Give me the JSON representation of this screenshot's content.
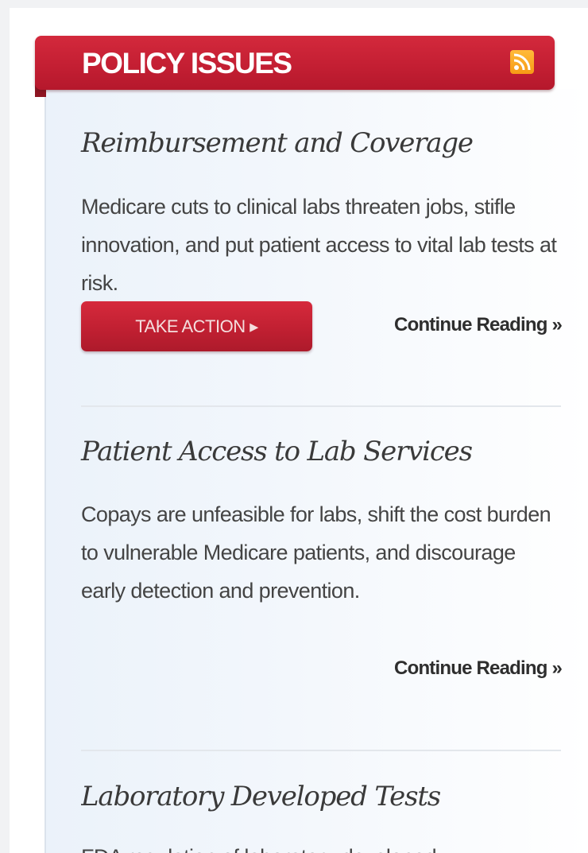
{
  "header": {
    "title": "POLICY ISSUES",
    "icon": "rss-feed-icon",
    "background_color": "#c41f33"
  },
  "articles": [
    {
      "title": "Reimbursement and Coverage",
      "summary": "Medicare cuts to clinical labs threaten jobs, stifle innovation, and put patient access to vital lab tests at risk.",
      "action_label": "TAKE ACTION ▸",
      "continue_label": "Continue Reading »"
    },
    {
      "title": "Patient Access to Lab Services",
      "summary": "Copays are unfeasible for labs, shift the cost burden to vulnerable Medicare patients, and discourage early detection and prevention.",
      "continue_label": "Continue Reading »"
    },
    {
      "title": "Laboratory Developed Tests",
      "summary": "FDA regulation of laboratory-developed"
    }
  ]
}
